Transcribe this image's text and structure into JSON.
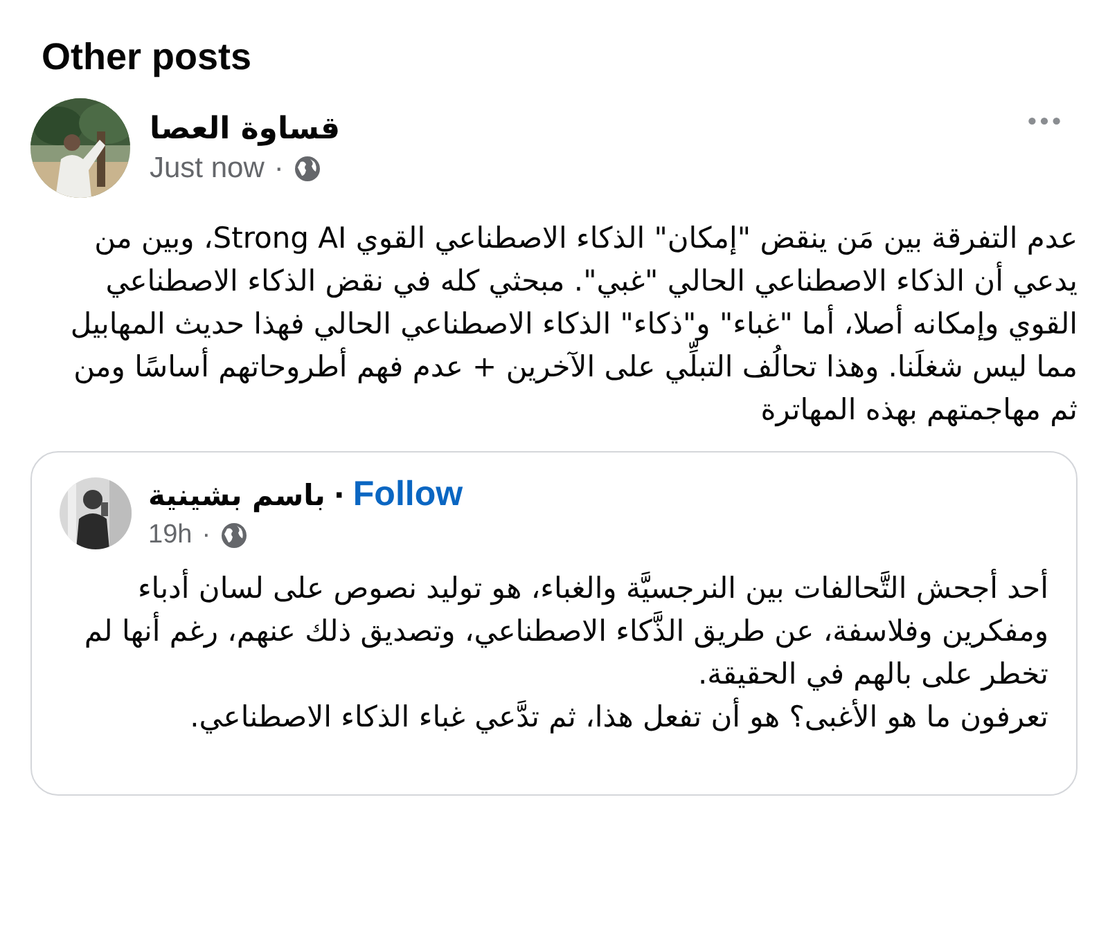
{
  "section_title": "Other posts",
  "post": {
    "author": "قساوة العصا",
    "time": "Just now",
    "separator": "·",
    "text": "عدم التفرقة بين مَن ينقض \"إمكان\" الذكاء الاصطناعي القوي Strong AI، وبين من يدعي أن الذكاء الاصطناعي الحالي \"غبي\".  مبحثي كله في نقض الذكاء الاصطناعي القوي وإمكانه أصلا، أما \"غباء\" و\"ذكاء\" الذكاء الاصطناعي الحالي فهذا حديث المهابيل مما ليس شغلَنا. وهذا تحالُف التبلِّي على الآخرين + عدم فهم أطروحاتهم أساسًا ومن ثم مهاجمتهم بهذه المهاترة"
  },
  "shared_post": {
    "author": "باسم بشينية",
    "separator": "·",
    "follow": "Follow",
    "time": "19h",
    "time_separator": "·",
    "paragraphs": [
      "أحد أجحش التَّحالفات بين النرجسيَّة والغباء، هو توليد نصوص على لسان أدباء ومفكرين وفلاسفة، عن طريق الذَّكاء الاصطناعي، وتصديق ذلك عنهم، رغم أنها لم تخطر على بالهم في الحقيقة.",
      "تعرفون ما هو الأغبى؟ هو أن تفعل هذا، ثم تدَّعي غباء الذكاء الاصطناعي."
    ]
  }
}
